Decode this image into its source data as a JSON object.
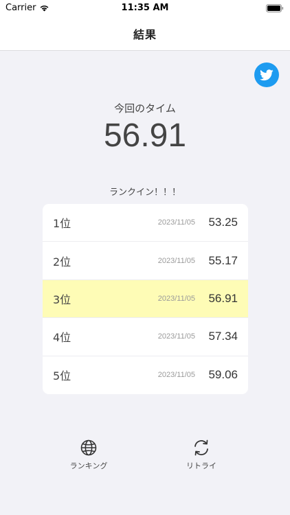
{
  "status_bar": {
    "carrier": "Carrier",
    "time": "11:35 AM"
  },
  "nav": {
    "title": "結果"
  },
  "result": {
    "caption": "今回のタイム",
    "time": "56.91",
    "rank_in_message": "ランクイン！！！"
  },
  "ranking": {
    "rows": [
      {
        "position": "1位",
        "date": "2023/11/05",
        "score": "53.25",
        "highlight": false
      },
      {
        "position": "2位",
        "date": "2023/11/05",
        "score": "55.17",
        "highlight": false
      },
      {
        "position": "3位",
        "date": "2023/11/05",
        "score": "56.91",
        "highlight": true
      },
      {
        "position": "4位",
        "date": "2023/11/05",
        "score": "57.34",
        "highlight": false
      },
      {
        "position": "5位",
        "date": "2023/11/05",
        "score": "59.06",
        "highlight": false
      }
    ]
  },
  "bottom": {
    "ranking_label": "ランキング",
    "retry_label": "リトライ"
  },
  "icons": {
    "share": "twitter-icon",
    "ranking": "globe-icon",
    "retry": "retry-icon"
  },
  "colors": {
    "background": "#f2f2f7",
    "highlight_row": "#fefcb6",
    "twitter": "#1d9bf0"
  }
}
